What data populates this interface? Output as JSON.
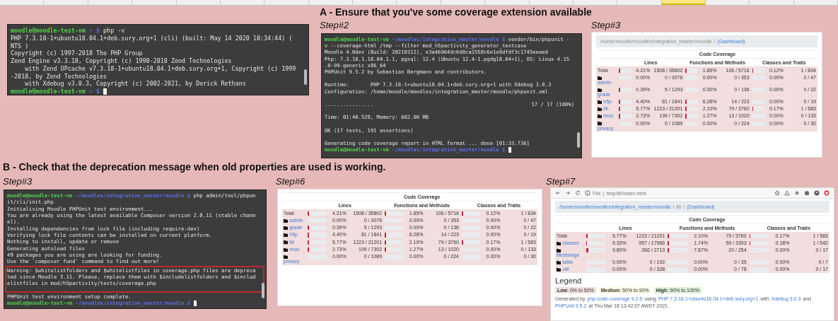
{
  "sheet": {
    "columns": [
      {
        "selected": false
      },
      {
        "selected": false
      },
      {
        "selected": false
      },
      {
        "selected": false
      },
      {
        "selected": false
      },
      {
        "selected": false
      },
      {
        "selected": false
      },
      {
        "selected": false
      },
      {
        "selected": false
      },
      {
        "selected": false
      },
      {
        "selected": false
      },
      {
        "selected": false
      },
      {
        "selected": false
      },
      {
        "selected": false
      },
      {
        "selected": false
      },
      {
        "selected": true
      },
      {
        "selected": false
      },
      {
        "selected": false
      },
      {
        "selected": false
      }
    ]
  },
  "sections": [
    {
      "title": "A - Ensure that you've some coverage extension available",
      "steps": [
        {
          "shot": {
            "kind": "terminal",
            "lines": [
              {
                "kind": "prompt",
                "user": "moodle@moodle-test-vm",
                "path": "~",
                "sign": "$",
                "command": "php -v"
              },
              {
                "kind": "output",
                "text": "PHP 7.3.18-1+ubuntu18.04.1+deb.sury.org+1 (cli) (built: May 14 2020 10:34:44) ("
              },
              {
                "kind": "output",
                "text": "NTS )"
              },
              {
                "kind": "output",
                "text": "Copyright (c) 1997-2018 The PHP Group"
              },
              {
                "kind": "output",
                "text": "Zend Engine v3.3.18, Copyright (c) 1998-2018 Zend Technologies"
              },
              {
                "kind": "output",
                "text": "    with Zend OPcache v7.3.18-1+ubuntu18.04.1+deb.sury.org+1, Copyright (c) 1999"
              },
              {
                "kind": "output",
                "text": "-2018, by Zend Technologies"
              },
              {
                "kind": "output",
                "text": "    with Xdebug v3.0.3, Copyright (c) 2002-2021, by Derick Rethans"
              },
              {
                "kind": "prompt",
                "user": "moodle@moodle-test-vm",
                "path": "~",
                "sign": "$",
                "cursor": true
              }
            ]
          }
        },
        {
          "label": "Step#2",
          "shot": {
            "kind": "terminal",
            "lines": [
              {
                "kind": "prompt",
                "user": "moodle@moodle-test-vm",
                "path": "~/moodles/integration_master/moodle",
                "sign": "$",
                "command": "vendor/bin/phpunit -"
              },
              {
                "kind": "output",
                "text": "v --coverage-html /tmp --filter mod_h5pactivity_generator_testcase"
              },
              {
                "kind": "output",
                "text": "Moodle 4.0dev (Build: 20210312), e3a46964dc6d8ca1558c6e1e8dfdf3c1745eeaed"
              },
              {
                "kind": "output",
                "text": "Php: 7.3.18.1.18.04.1.1, pgsql: 12.4 (Ubuntu 12.4-1.pgdg18.04+1), OS: Linux 4.15"
              },
              {
                "kind": "output",
                "text": ".0-99-generic x86_64"
              },
              {
                "kind": "output",
                "text": "PHPUnit 9.5.2 by Sebastian Bergmann and contributors."
              },
              {
                "kind": "blank"
              },
              {
                "kind": "output",
                "text": "Runtime:       PHP 7.3.18-1+ubuntu18.04.1+deb.sury.org+1 with Xdebug 3.0.3"
              },
              {
                "kind": "output",
                "text": "Configuration: /home/moodle/moodles/integration_master/moodle/phpunit.xml"
              },
              {
                "kind": "blank"
              },
              {
                "kind": "progress",
                "text": "................",
                "count": "17 / 17 (100%)"
              },
              {
                "kind": "blank"
              },
              {
                "kind": "output",
                "text": "Time: 01:40.528, Memory: 602.00 MB"
              },
              {
                "kind": "blank"
              },
              {
                "kind": "output",
                "text": "OK (17 tests, 191 assertions)"
              },
              {
                "kind": "blank"
              },
              {
                "kind": "output",
                "text": "Generating code coverage report in HTML format ... done [01:33.736]"
              },
              {
                "kind": "prompt",
                "user": "moodle@moodle-test-vm",
                "path": "~/moodles/integration_master/moodle",
                "sign": "$",
                "cursor": true
              }
            ]
          }
        },
        {
          "label": "Step#3",
          "shot": {
            "kind": "coverage",
            "breadcrumb": {
              "separator": "/",
              "items": [
                {
                  "text": "/home/moodle/moodles/integration_master/moodle",
                  "link": false
                },
                {
                  "text": "(Dashboard)",
                  "link": true
                }
              ]
            },
            "table": {
              "title": "Code Coverage",
              "groups": [
                "Lines",
                "Functions and Methods",
                "Classes and Traits"
              ],
              "rows": [
                {
                  "kind": "total",
                  "name": "Total",
                  "metrics": [
                    {
                      "level": 0.0421,
                      "percent": "4.21%",
                      "ratio": "1508 / 35802"
                    },
                    {
                      "level": 0.0185,
                      "percent": "1.85%",
                      "ratio": "106 / 5716"
                    },
                    {
                      "level": 0.0012,
                      "percent": "0.12%",
                      "ratio": "1 / 834"
                    }
                  ]
                },
                {
                  "kind": "folder",
                  "name": "admin",
                  "metrics": [
                    {
                      "percent": "0.00%",
                      "ratio": "0 / 3076"
                    },
                    {
                      "percent": "0.00%",
                      "ratio": "0 / 353"
                    },
                    {
                      "percent": "0.00%",
                      "ratio": "0 / 47"
                    }
                  ]
                },
                {
                  "kind": "folder",
                  "name": "grade",
                  "metrics": [
                    {
                      "level": 0.0039,
                      "percent": "0.39%",
                      "ratio": "5 / 1293"
                    },
                    {
                      "percent": "0.00%",
                      "ratio": "0 / 136"
                    },
                    {
                      "percent": "0.00%",
                      "ratio": "0 / 22"
                    }
                  ]
                },
                {
                  "kind": "folder",
                  "name": "h5p",
                  "metrics": [
                    {
                      "level": 0.044,
                      "percent": "4.40%",
                      "ratio": "81 / 1841"
                    },
                    {
                      "level": 0.0628,
                      "percent": "6.28%",
                      "ratio": "14 / 223"
                    },
                    {
                      "percent": "0.00%",
                      "ratio": "0 / 19"
                    }
                  ]
                },
                {
                  "kind": "folder",
                  "name": "lib",
                  "metrics": [
                    {
                      "level": 0.0577,
                      "percent": "5.77%",
                      "ratio": "1223 / 21201"
                    },
                    {
                      "level": 0.021,
                      "percent": "2.10%",
                      "ratio": "79 / 3760"
                    },
                    {
                      "level": 0.0017,
                      "percent": "0.17%",
                      "ratio": "1 / 583"
                    }
                  ]
                },
                {
                  "kind": "folder",
                  "name": "mod",
                  "metrics": [
                    {
                      "level": 0.0273,
                      "percent": "2.73%",
                      "ratio": "199 / 7302"
                    },
                    {
                      "level": 0.0127,
                      "percent": "1.27%",
                      "ratio": "13 / 1020"
                    },
                    {
                      "percent": "0.00%",
                      "ratio": "0 / 133"
                    }
                  ]
                },
                {
                  "kind": "folder",
                  "name": "privacy",
                  "metrics": [
                    {
                      "percent": "0.00%",
                      "ratio": "0 / 1089"
                    },
                    {
                      "percent": "0.00%",
                      "ratio": "0 / 224"
                    },
                    {
                      "percent": "0.00%",
                      "ratio": "0 / 30"
                    }
                  ]
                }
              ]
            }
          }
        }
      ]
    },
    {
      "title": "B - Check that the deprecation message when old properties are used is working.",
      "steps": [
        {
          "label": "Step#3",
          "shot": {
            "kind": "terminal",
            "lines": [
              {
                "kind": "prompt",
                "user": "moodle@moodle-test-vm",
                "path": "~/moodles/integration_master/moodle",
                "sign": "$",
                "command": "php admin/tool/phpun"
              },
              {
                "kind": "output",
                "text": "it/cli/init.php"
              },
              {
                "kind": "output",
                "text": "Initialising Moodle PHPUnit test environment..."
              },
              {
                "kind": "output",
                "text": "You are already using the latest available Composer version 2.0.11 (stable chann"
              },
              {
                "kind": "output",
                "text": "el)."
              },
              {
                "kind": "output",
                "text": "Installing dependencies from lock file (including require-dev)"
              },
              {
                "kind": "output",
                "text": "Verifying lock file contents can be installed on current platform."
              },
              {
                "kind": "output",
                "text": "Nothing to install, update or remove"
              },
              {
                "kind": "output",
                "text": "Generating autoload files"
              },
              {
                "kind": "output",
                "text": "49 packages you are using are looking for funding."
              },
              {
                "kind": "output",
                "text": "Use the `composer fund` command to find out more!"
              },
              {
                "kind": "highlight",
                "lines": [
                  "Warning: $whitelistfolders and $whitelistfiles in coverage.php files are depreca",
                  "ted since Moodle 3.11. Please, replace them with $includelistfolders and $includ",
                  "elistfiles in mod/h5pactivity/tests/coverage.php"
                ]
              },
              {
                "kind": "output",
                "text": "PHPUnit test environment setup complete."
              },
              {
                "kind": "prompt",
                "user": "moodle@moodle-test-vm",
                "path": "~/moodles/integration_master/moodle",
                "sign": "$",
                "cursor": true
              }
            ]
          }
        },
        {
          "label": "Step#6",
          "shot": {
            "kind": "coverage",
            "table": {
              "title": "Code Coverage",
              "groups": [
                "Lines",
                "Functions and Methods",
                "Classes and Traits"
              ],
              "rows": [
                {
                  "kind": "total",
                  "name": "Total",
                  "metrics": [
                    {
                      "level": 0.0421,
                      "percent": "4.21%",
                      "ratio": "1508 / 35802"
                    },
                    {
                      "level": 0.0185,
                      "percent": "1.85%",
                      "ratio": "106 / 5716"
                    },
                    {
                      "level": 0.0012,
                      "percent": "0.12%",
                      "ratio": "1 / 834"
                    }
                  ]
                },
                {
                  "kind": "folder",
                  "name": "admin",
                  "metrics": [
                    {
                      "percent": "0.00%",
                      "ratio": "0 / 3076"
                    },
                    {
                      "percent": "0.00%",
                      "ratio": "0 / 353"
                    },
                    {
                      "percent": "0.00%",
                      "ratio": "0 / 47"
                    }
                  ]
                },
                {
                  "kind": "folder",
                  "name": "grade",
                  "metrics": [
                    {
                      "level": 0.0039,
                      "percent": "0.39%",
                      "ratio": "5 / 1293"
                    },
                    {
                      "percent": "0.00%",
                      "ratio": "0 / 136"
                    },
                    {
                      "percent": "0.00%",
                      "ratio": "0 / 22"
                    }
                  ]
                },
                {
                  "kind": "folder",
                  "name": "h5p",
                  "metrics": [
                    {
                      "level": 0.044,
                      "percent": "4.40%",
                      "ratio": "81 / 1841"
                    },
                    {
                      "level": 0.0628,
                      "percent": "6.28%",
                      "ratio": "14 / 223"
                    },
                    {
                      "percent": "0.00%",
                      "ratio": "0 / 19"
                    }
                  ]
                },
                {
                  "kind": "folder",
                  "name": "lib",
                  "metrics": [
                    {
                      "level": 0.0577,
                      "percent": "5.77%",
                      "ratio": "1223 / 21201"
                    },
                    {
                      "level": 0.021,
                      "percent": "2.10%",
                      "ratio": "79 / 3760"
                    },
                    {
                      "level": 0.0017,
                      "percent": "0.17%",
                      "ratio": "1 / 583"
                    }
                  ]
                },
                {
                  "kind": "folder",
                  "name": "mod",
                  "metrics": [
                    {
                      "level": 0.0273,
                      "percent": "2.73%",
                      "ratio": "199 / 7302"
                    },
                    {
                      "level": 0.0127,
                      "percent": "1.27%",
                      "ratio": "13 / 1020"
                    },
                    {
                      "percent": "0.00%",
                      "ratio": "0 / 133"
                    }
                  ]
                },
                {
                  "kind": "folder",
                  "name": "privacy",
                  "metrics": [
                    {
                      "percent": "0.00%",
                      "ratio": "0 / 1089"
                    },
                    {
                      "percent": "0.00%",
                      "ratio": "0 / 224"
                    },
                    {
                      "percent": "0.00%",
                      "ratio": "0 / 30"
                    }
                  ]
                }
              ]
            }
          }
        },
        {
          "label": "Step#7",
          "shot": {
            "kind": "coverage",
            "browser": {
              "address_prefix": "File",
              "address_separator": "|",
              "address": "/tmp/lib/index.html"
            },
            "breadcrumb": {
              "separator": "/",
              "items": [
                {
                  "text": "/home/moodle/moodles/integration_master/moodle",
                  "link": true
                },
                {
                  "text": "lib",
                  "link": false
                },
                {
                  "text": "(Dashboard)",
                  "link": true
                }
              ]
            },
            "table": {
              "title": "Code Coverage",
              "groups": [
                "Lines",
                "Functions and Methods",
                "Classes and Traits"
              ],
              "rows": [
                {
                  "kind": "total",
                  "name": "Total",
                  "metrics": [
                    {
                      "level": 0.0577,
                      "percent": "5.77%",
                      "ratio": "1223 / 21201"
                    },
                    {
                      "level": 0.021,
                      "percent": "2.10%",
                      "ratio": "79 / 3760"
                    },
                    {
                      "level": 0.0017,
                      "percent": "0.17%",
                      "ratio": "1 / 583"
                    }
                  ]
                },
                {
                  "kind": "folder",
                  "name": "classes",
                  "metrics": [
                    {
                      "level": 0.0533,
                      "percent": "5.33%",
                      "ratio": "957 / 17966"
                    },
                    {
                      "level": 0.0174,
                      "percent": "1.74%",
                      "ratio": "59 / 3393"
                    },
                    {
                      "level": 0.0018,
                      "percent": "0.18%",
                      "ratio": "1 / 542"
                    }
                  ]
                },
                {
                  "kind": "folder",
                  "name": "filestorage",
                  "metrics": [
                    {
                      "level": 0.098,
                      "percent": "9.80%",
                      "ratio": "266 / 2713"
                    },
                    {
                      "level": 0.0787,
                      "percent": "7.87%",
                      "ratio": "20 / 254"
                    },
                    {
                      "percent": "0.00%",
                      "ratio": "0 / 17"
                    }
                  ]
                },
                {
                  "kind": "folder",
                  "name": "table",
                  "metrics": [
                    {
                      "percent": "0.00%",
                      "ratio": "0 / 192"
                    },
                    {
                      "percent": "0.00%",
                      "ratio": "0 / 35"
                    },
                    {
                      "percent": "0.00%",
                      "ratio": "0 / 7"
                    }
                  ]
                },
                {
                  "kind": "folder",
                  "name": "util",
                  "metrics": [
                    {
                      "percent": "0.00%",
                      "ratio": "0 / 328"
                    },
                    {
                      "percent": "0.00%",
                      "ratio": "0 / 78"
                    },
                    {
                      "percent": "0.00%",
                      "ratio": "0 / 17"
                    }
                  ]
                }
              ]
            },
            "legend": {
              "title": "Legend",
              "items": [
                {
                  "kind": "low",
                  "text": "**Low**: 0% to 50%"
                },
                {
                  "kind": "medium",
                  "text": "**Medium**: 50% to 90%"
                },
                {
                  "kind": "high",
                  "text": "**High**: 90% to 100%"
                }
              ]
            },
            "footer": [
              {
                "text": "Generated by",
                "link": false
              },
              {
                "text": "php-code-coverage 9.2.5",
                "link": true
              },
              {
                "text": "using",
                "link": false
              },
              {
                "text": "PHP 7.3.18-1+ubuntu18.04.1+deb.sury.org+1",
                "link": true
              },
              {
                "text": "with",
                "link": false
              },
              {
                "text": "Xdebug 3.0.3",
                "link": true
              },
              {
                "text": "and",
                "link": false
              },
              {
                "text": "PHPUnit 9.5.2",
                "link": true
              },
              {
                "text": "at Thu Mar 18 13:42:07 AWST 2021.",
                "link": false
              }
            ]
          }
        }
      ]
    }
  ]
}
